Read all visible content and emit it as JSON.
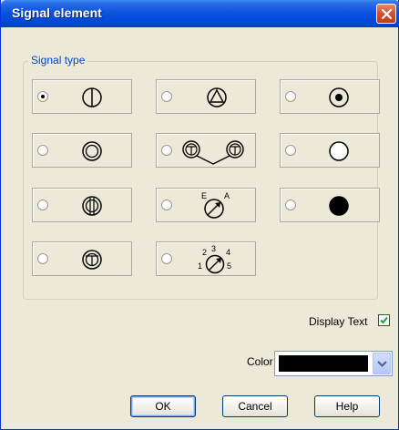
{
  "window": {
    "title": "Signal element"
  },
  "group": {
    "label": "Signal type"
  },
  "options": [
    {
      "id": "lamp-vertical-divided",
      "symbol_icon": "circle-vertical-line-icon",
      "checked": true
    },
    {
      "id": "lamp-triangle",
      "symbol_icon": "circle-triangle-icon",
      "checked": false
    },
    {
      "id": "lamp-dot",
      "symbol_icon": "circle-dot-icon",
      "checked": false
    },
    {
      "id": "lamp-double-ring",
      "symbol_icon": "double-circle-icon",
      "checked": false
    },
    {
      "id": "lamp-double-t-connected",
      "symbol_icon": "double-t-lamps-icon",
      "checked": false
    },
    {
      "id": "lamp-empty",
      "symbol_icon": "empty-circle-icon",
      "checked": false
    },
    {
      "id": "lamp-double-vertical",
      "symbol_icon": "circle-double-vertical-icon",
      "checked": false
    },
    {
      "id": "meter-ea",
      "symbol_icon": "gauge-ea-icon",
      "checked": false,
      "labels": [
        "E",
        "A"
      ]
    },
    {
      "id": "lamp-filled",
      "symbol_icon": "filled-circle-icon",
      "checked": false
    },
    {
      "id": "lamp-t-ring",
      "symbol_icon": "circle-t-icon",
      "checked": false
    },
    {
      "id": "meter-multi",
      "symbol_icon": "gauge-multi-icon",
      "checked": false,
      "labels": [
        "2",
        "3",
        "4",
        "1",
        "5"
      ]
    }
  ],
  "display_text": {
    "label": "Display Text",
    "checked": true
  },
  "color": {
    "label": "Color",
    "value": "#000000"
  },
  "buttons": {
    "ok": "OK",
    "cancel": "Cancel",
    "help": "Help"
  }
}
